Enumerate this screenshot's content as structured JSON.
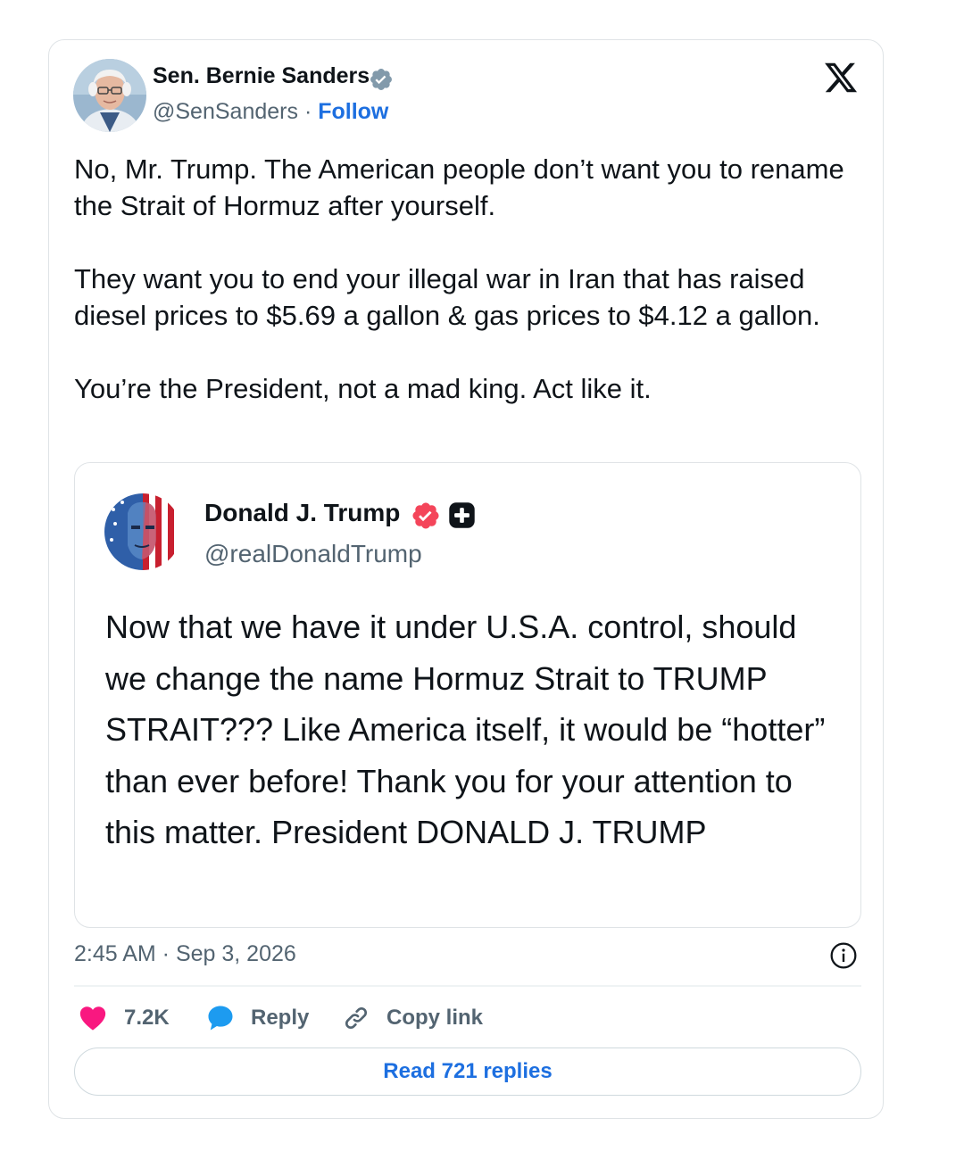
{
  "tweet": {
    "author": {
      "name": "Sen. Bernie Sanders",
      "handle": "@SenSanders",
      "separator": "·",
      "follow_label": "Follow",
      "avatar_icon": "bernie-sanders-avatar",
      "verified_color": "#829aab"
    },
    "paragraphs": [
      "No, Mr. Trump. The American people don’t want you to rename the Strait of Hormuz after yourself.",
      "They want you to end your illegal war in Iran that has raised diesel prices to $5.69 a gallon & gas prices to $4.12 a gallon.",
      "You’re the President, not a mad king. Act like it."
    ],
    "quoted": {
      "name": "Donald J. Trump",
      "handle": "@realDonaldTrump",
      "avatar_icon": "donald-trump-avatar",
      "verified_color": "#f4212e",
      "text": "Now that we have it under U.S.A. control, should we change the name Hormuz Strait to TRUMP STRAIT??? Like America itself, it would be “hotter” than ever before! Thank you for your attention to this matter. President DONALD J. TRUMP"
    },
    "timestamp": "2:45 AM · Sep 3, 2026",
    "actions": {
      "likes": "7.2K",
      "reply_label": "Reply",
      "copy_label": "Copy link"
    },
    "read_replies_label": "Read 721 replies"
  },
  "colors": {
    "link_blue": "#1d6fe0",
    "like_pink": "#f91880",
    "reply_blue": "#1d9bf0",
    "secondary_text": "#536471"
  }
}
